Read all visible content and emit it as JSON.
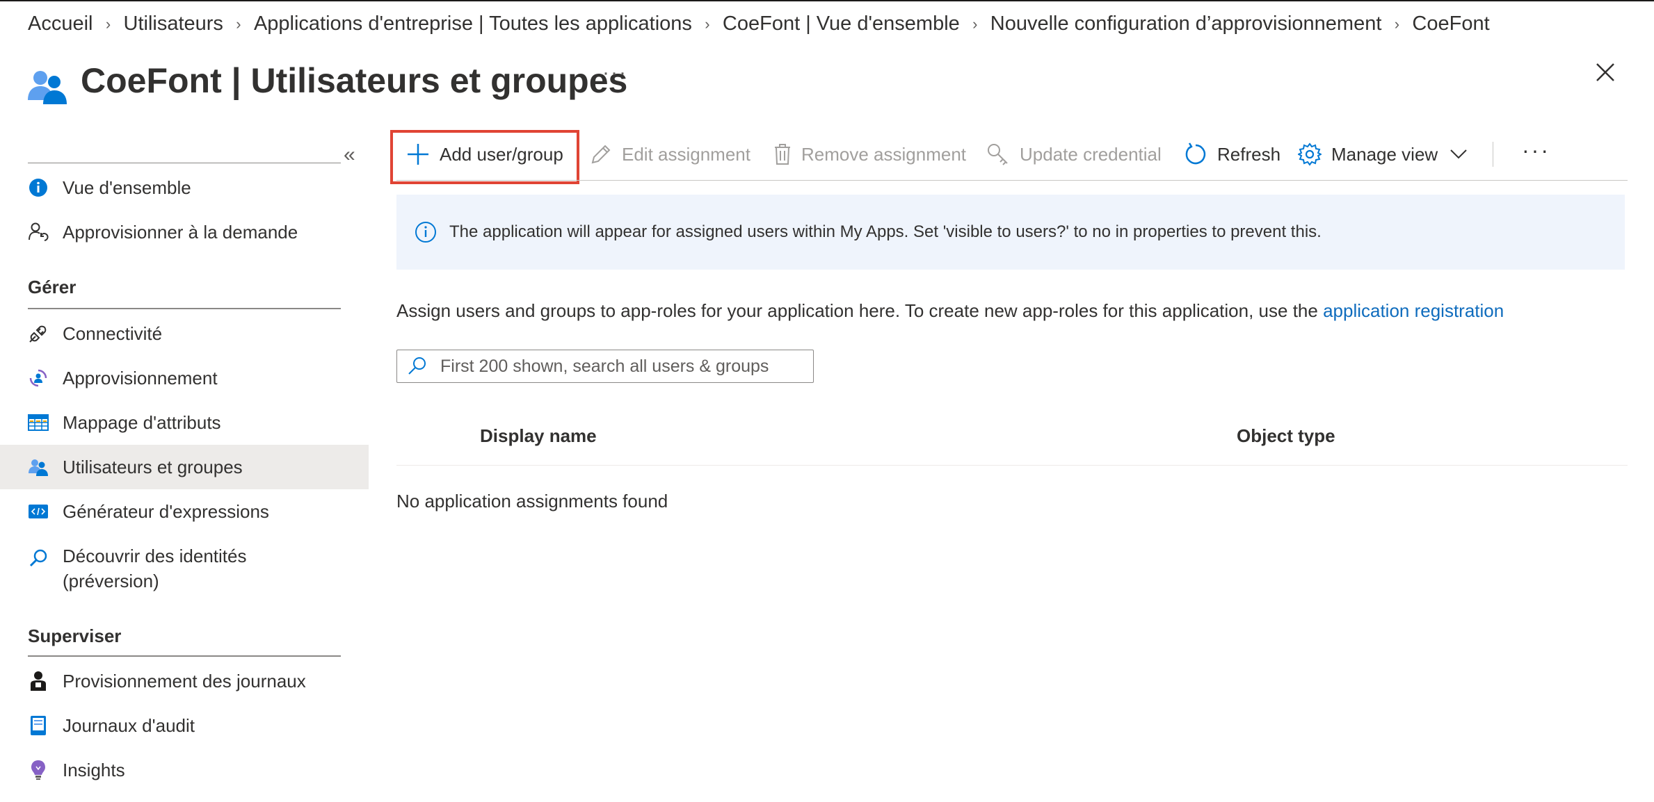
{
  "breadcrumb": [
    {
      "label": "Accueil"
    },
    {
      "label": "Utilisateurs"
    },
    {
      "label": "Applications d'entreprise | Toutes les applications"
    },
    {
      "label": "CoeFont | Vue d'ensemble"
    },
    {
      "label": "Nouvelle configuration d’approvisionnement"
    },
    {
      "label": "CoeFont"
    }
  ],
  "header": {
    "app_name": "CoeFont",
    "separator": " | ",
    "page_title": "Utilisateurs et groupes",
    "more_label": "···"
  },
  "sidebar": {
    "collapse_label": "«",
    "items_top": [
      {
        "label": "Vue d'ensemble",
        "icon": "info-icon"
      },
      {
        "label": "Approvisionner à la demande",
        "icon": "user-sync-icon"
      }
    ],
    "manage_heading": "Gérer",
    "items_manage": [
      {
        "label": "Connectivité",
        "icon": "plug-icon"
      },
      {
        "label": "Approvisionnement",
        "icon": "provisioning-icon"
      },
      {
        "label": "Mappage d'attributs",
        "icon": "table-icon"
      },
      {
        "label": "Utilisateurs et groupes",
        "icon": "users-icon",
        "active": true
      },
      {
        "label": "Générateur d'expressions",
        "icon": "code-icon"
      },
      {
        "label": "Découvrir des identités",
        "label_line2": "(préversion)",
        "icon": "search-icon"
      }
    ],
    "monitor_heading": "Superviser",
    "items_monitor": [
      {
        "label": "Provisionnement des journaux",
        "icon": "person-log-icon"
      },
      {
        "label": "Journaux d'audit",
        "icon": "book-icon"
      },
      {
        "label": "Insights",
        "icon": "lightbulb-icon"
      }
    ]
  },
  "toolbar": {
    "add": "Add user/group",
    "edit": "Edit assignment",
    "remove": "Remove assignment",
    "update": "Update credential",
    "refresh": "Refresh",
    "manage_view": "Manage view",
    "more": "···"
  },
  "info_banner": "The application will appear for assigned users within My Apps. Set 'visible to users?' to no in properties to prevent this.",
  "description": {
    "text": "Assign users and groups to app-roles for your application here. To create new app-roles for this application, use the ",
    "link": "application registration"
  },
  "search": {
    "placeholder": "First 200 shown, search all users & groups",
    "value": ""
  },
  "table": {
    "columns": [
      "Display name",
      "Object type"
    ],
    "empty_message": "No application assignments found"
  },
  "colors": {
    "accent": "#0f6cbd",
    "highlight": "#e04434",
    "banner_bg": "#eff4fc",
    "active_bg": "#edebe9"
  }
}
